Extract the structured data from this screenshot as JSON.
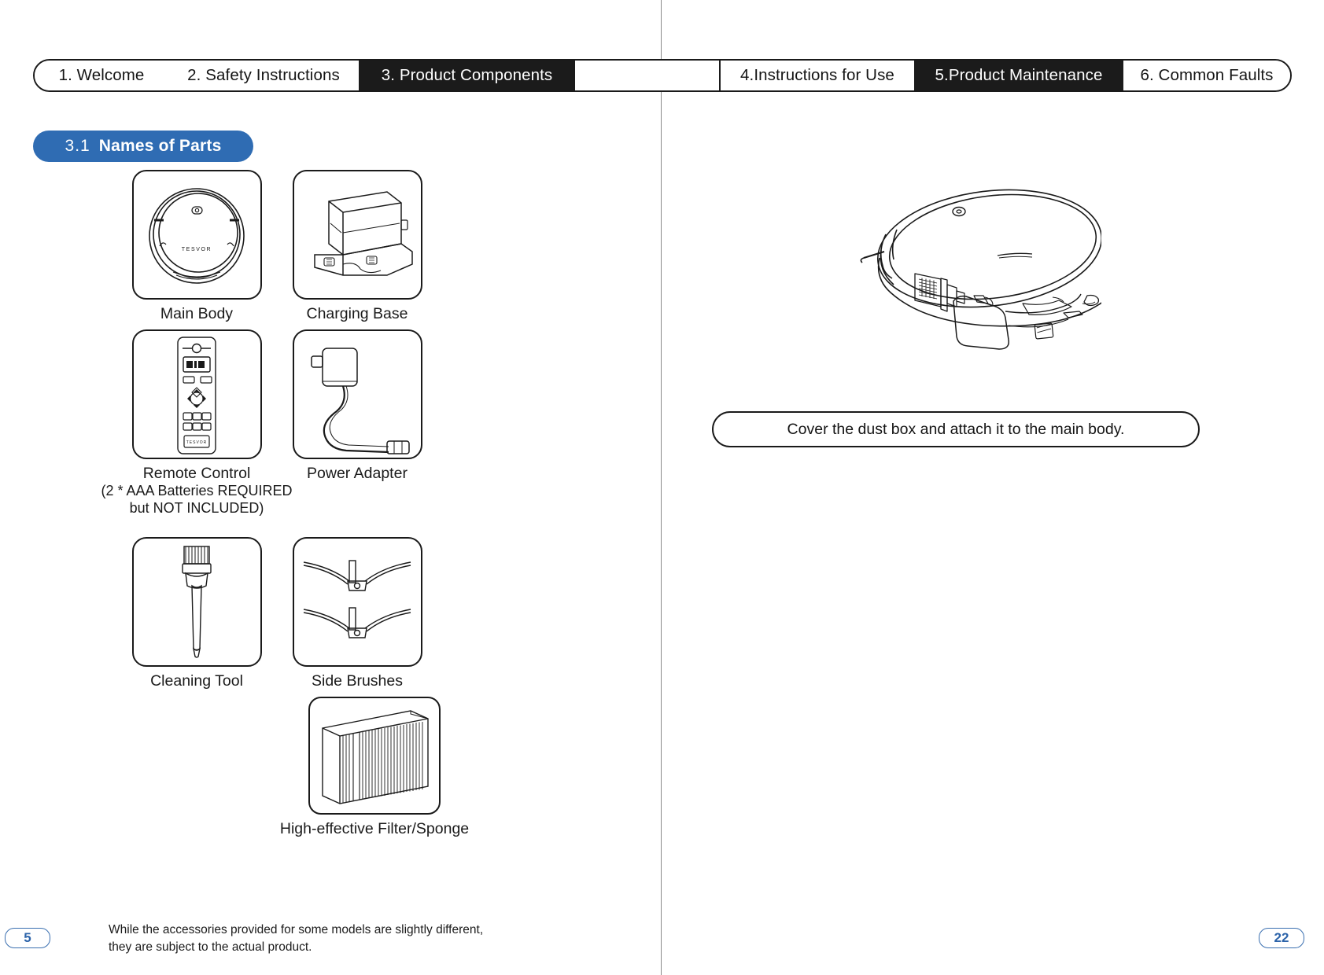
{
  "tabbar": {
    "tabs": [
      {
        "label": "1.  Welcome",
        "active": false
      },
      {
        "label": "2. Safety Instructions",
        "active": false
      },
      {
        "label": "3. Product Components",
        "active": true
      },
      {
        "label": "",
        "active": false
      },
      {
        "label": "4.Instructions for Use",
        "active": false
      },
      {
        "label": "5.Product Maintenance",
        "active": true
      },
      {
        "label": "6. Common Faults",
        "active": false
      }
    ]
  },
  "section": {
    "number": "3.1",
    "title": "Names of Parts"
  },
  "parts": [
    {
      "name": "main-body",
      "label": "Main Body",
      "sub": ""
    },
    {
      "name": "charging-base",
      "label": "Charging Base",
      "sub": ""
    },
    {
      "name": "remote-control",
      "label": "Remote Control",
      "sub_line1": "(2 * AAA Batteries REQUIRED",
      "sub_line2": "but NOT INCLUDED)"
    },
    {
      "name": "power-adapter",
      "label": "Power Adapter",
      "sub": ""
    },
    {
      "name": "cleaning-tool",
      "label": "Cleaning Tool",
      "sub": ""
    },
    {
      "name": "side-brushes",
      "label": "Side Brushes",
      "sub": ""
    },
    {
      "name": "filter-sponge",
      "label": "High-effective Filter/Sponge",
      "sub": ""
    }
  ],
  "footnote": {
    "line1": "While the accessories provided for some models are slightly different,",
    "line2": "they are subject to the actual product."
  },
  "pages": {
    "left": "5",
    "right": "22"
  },
  "right_page": {
    "callout": "Cover the dust box and attach it to the main body.",
    "illustration": "robot-vacuum-isometric"
  },
  "branding": {
    "logo_text": "TESVOR"
  },
  "colors": {
    "accent_blue": "#2f6cb3",
    "page_number_blue": "#2d64aa",
    "ink": "#1a1a1a",
    "tab_active_bg": "#1b1b1b"
  }
}
